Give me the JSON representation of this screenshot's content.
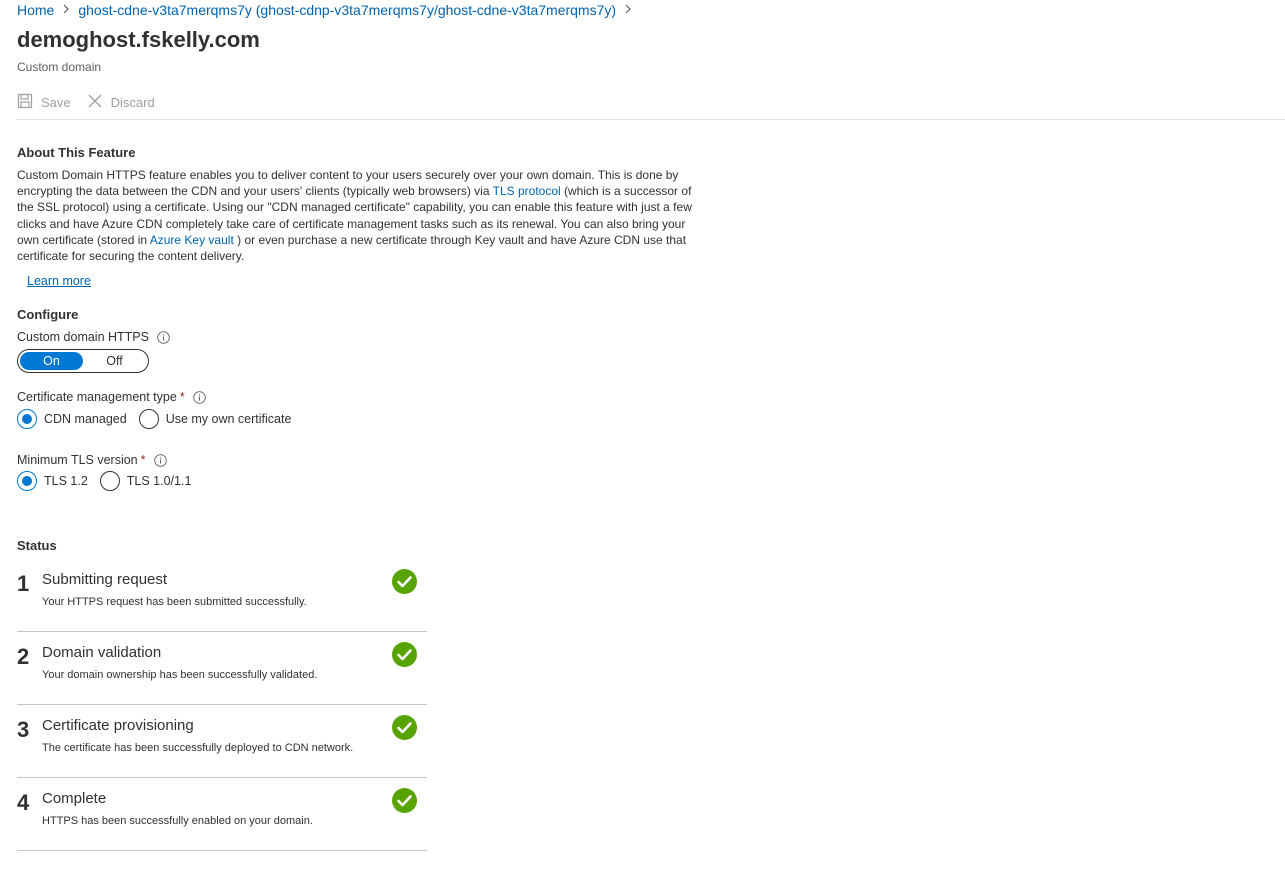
{
  "breadcrumb": {
    "home": "Home",
    "sep": ">",
    "resource": "ghost-cdne-v3ta7merqms7y (ghost-cdnp-v3ta7merqms7y/ghost-cdne-v3ta7merqms7y)"
  },
  "header": {
    "title": "demoghost.fskelly.com",
    "subtitle": "Custom domain"
  },
  "toolbar": {
    "save_label": "Save",
    "discard_label": "Discard"
  },
  "about": {
    "heading": "About This Feature",
    "text_part1": "Custom Domain HTTPS feature enables you to deliver content to your users securely over your own domain. This is done by encrypting the data between the CDN and your users' clients (typically web browsers) via ",
    "tls_link": "TLS protocol",
    "text_part2": " (which is a successor of the SSL protocol) using a certificate. Using our \"CDN managed certificate\" capability, you can enable this feature with just a few clicks and have Azure CDN completely take care of certificate management tasks such as its renewal. You can also bring your own certificate (stored in ",
    "keyvault_link": "Azure Key vault",
    "text_part3": " ) or even purchase a new certificate through Key vault and have Azure CDN use that certificate for securing the content delivery.",
    "learn_more": "Learn more"
  },
  "configure": {
    "heading": "Configure",
    "https_label": "Custom domain HTTPS",
    "toggle_on": "On",
    "toggle_off": "Off",
    "cert_type_label": "Certificate management type",
    "required_mark": "*",
    "cert_options": [
      "CDN managed",
      "Use my own certificate"
    ],
    "tls_label": "Minimum TLS version",
    "tls_options": [
      "TLS 1.2",
      "TLS 1.0/1.1"
    ]
  },
  "status": {
    "heading": "Status",
    "steps": [
      {
        "num": "1",
        "title": "Submitting request",
        "desc": "Your HTTPS request has been submitted successfully."
      },
      {
        "num": "2",
        "title": "Domain validation",
        "desc": "Your domain ownership has been successfully validated."
      },
      {
        "num": "3",
        "title": "Certificate provisioning",
        "desc": "The certificate has been successfully deployed to CDN network."
      },
      {
        "num": "4",
        "title": "Complete",
        "desc": "HTTPS has been successfully enabled on your domain."
      }
    ]
  },
  "colors": {
    "accent": "#0078d4",
    "link": "#0063b1",
    "success": "#57a300",
    "required": "#a4262c"
  }
}
